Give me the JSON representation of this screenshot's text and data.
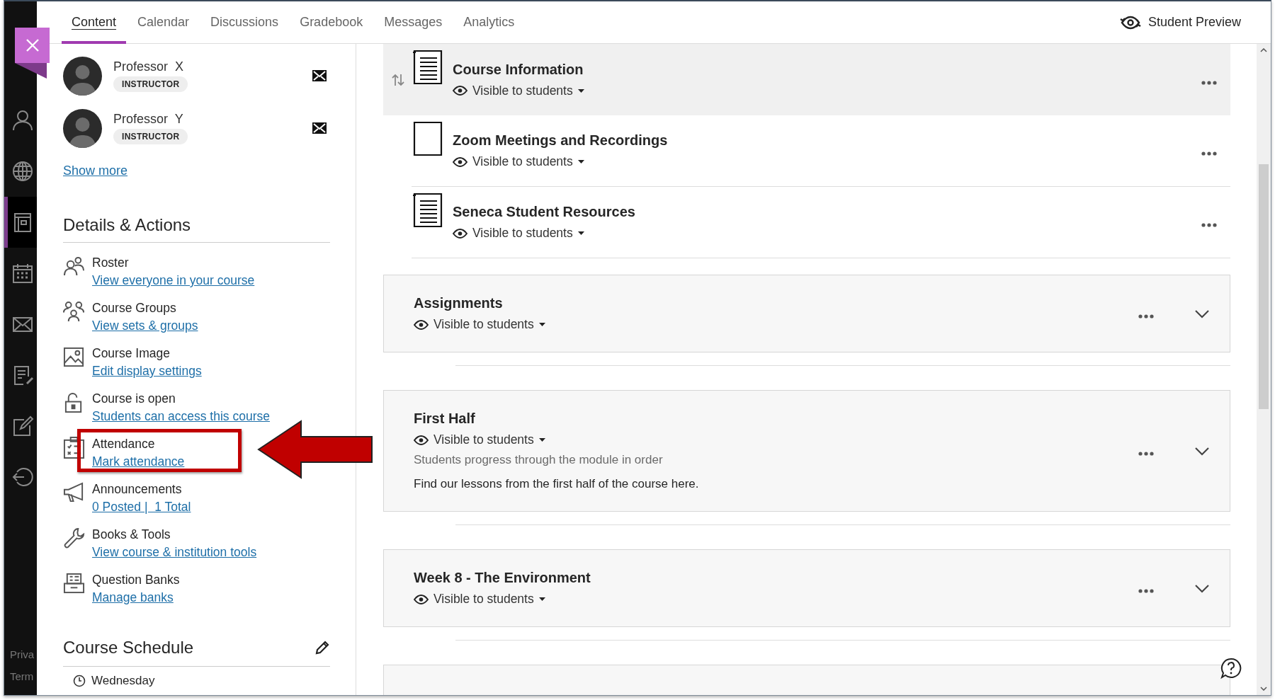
{
  "rail": {
    "items": [
      {
        "kind": "person",
        "selected": false
      },
      {
        "kind": "globe",
        "selected": false
      },
      {
        "kind": "courses",
        "selected": true
      },
      {
        "kind": "calendar",
        "selected": false
      },
      {
        "kind": "mail",
        "selected": false
      },
      {
        "kind": "grades",
        "selected": false
      },
      {
        "kind": "edit",
        "selected": false
      },
      {
        "kind": "signout",
        "selected": false
      }
    ],
    "footer": [
      "Priva",
      "Term"
    ]
  },
  "tabs": [
    {
      "label": "Content",
      "selected": true
    },
    {
      "label": "Calendar",
      "selected": false
    },
    {
      "label": "Discussions",
      "selected": false
    },
    {
      "label": "Gradebook",
      "selected": false
    },
    {
      "label": "Messages",
      "selected": false
    },
    {
      "label": "Analytics",
      "selected": false
    }
  ],
  "student_preview": "Student Preview",
  "instructors": [
    {
      "name": "Professor  X",
      "role": "INSTRUCTOR"
    },
    {
      "name": "Professor  Y",
      "role": "INSTRUCTOR"
    }
  ],
  "show_more": "Show more",
  "details": {
    "heading": "Details & Actions",
    "items": [
      {
        "kind": "roster",
        "title": "Roster",
        "link": "View everyone in your course"
      },
      {
        "kind": "groups",
        "title": "Course Groups",
        "link": "View sets & groups"
      },
      {
        "kind": "image",
        "title": "Course Image",
        "link": "Edit display settings"
      },
      {
        "kind": "lock",
        "title": "Course is open",
        "link": "Students can access this course"
      },
      {
        "kind": "attendance",
        "title": "Attendance",
        "link": "Mark attendance"
      },
      {
        "kind": "megaphone",
        "title": "Announcements",
        "link": "0 Posted |  1 Total"
      },
      {
        "kind": "wrench",
        "title": "Books & Tools",
        "link": "View course & institution tools"
      },
      {
        "kind": "bank",
        "title": "Question Banks",
        "link": "Manage banks"
      }
    ]
  },
  "schedule": {
    "heading": "Course Schedule",
    "day": "Wednesday"
  },
  "content_items": [
    {
      "kind": "document",
      "title": "Course Information",
      "visibility": "Visible to students",
      "hovered": true
    },
    {
      "kind": "blank",
      "title": "Zoom Meetings and Recordings",
      "visibility": "Visible to students",
      "hovered": false
    },
    {
      "kind": "document",
      "title": "Seneca Student Resources",
      "visibility": "Visible to students",
      "hovered": false
    }
  ],
  "folders": [
    {
      "title": "Assignments",
      "visibility": "Visible to students"
    },
    {
      "title": "First Half",
      "visibility": "Visible to students",
      "progress_note": "Students progress through the module in order",
      "description": "Find our lessons from the first half of the course here."
    },
    {
      "title": "Week 8 - The Environment",
      "visibility": "Visible to students"
    }
  ],
  "more_below": true
}
